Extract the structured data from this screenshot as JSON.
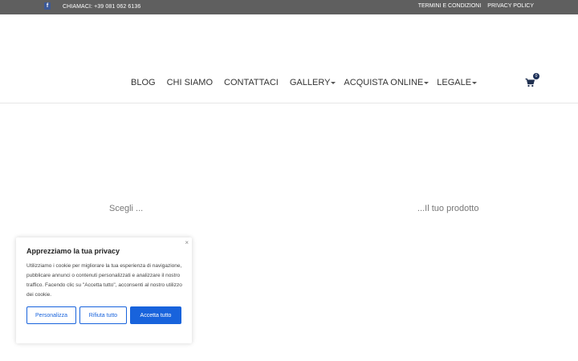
{
  "topbar": {
    "facebook_icon": "facebook-icon",
    "phone": "CHIAMACI: +39 081 062 6136",
    "links": [
      "TERMINI E CONDIZIONI",
      "PRIVACY POLICY"
    ]
  },
  "nav": {
    "items": [
      "BLOG",
      "CHI SIAMO",
      "CONTATTACI",
      "GALLERY",
      "ACQUISTA ONLINE",
      "LEGALE"
    ],
    "cart_count": "0",
    "cart_icon": "cart-icon"
  },
  "content": {
    "left_label": "Scegli ...",
    "right_label": "...Il tuo prodotto"
  },
  "cookie": {
    "title": "Apprezziamo la tua privacy",
    "text": "Utilizziamo i cookie per migliorare la tua esperienza di navigazione, pubblicare annunci o contenuti personalizzati e analizzare il nostro traffico. Facendo clic su \"Accetta tutto\", acconsenti al nostro utilizzo dei cookie.",
    "close": "×",
    "buttons": [
      "Personalizza",
      "Rifiuta tutto",
      "Accetta tutto"
    ],
    "accent": "#1863dc"
  }
}
